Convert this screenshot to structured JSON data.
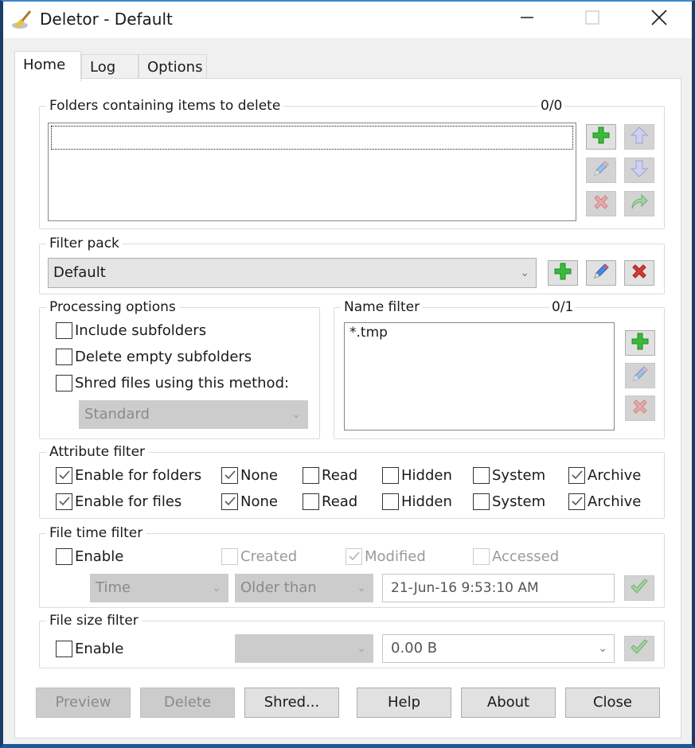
{
  "window": {
    "title": "Deletor - Default",
    "app_icon": "broom-icon",
    "controls": [
      "minimize-icon",
      "maximize-icon",
      "close-icon"
    ]
  },
  "tabs": [
    {
      "label": "Home",
      "active": true
    },
    {
      "label": "Log",
      "active": false
    },
    {
      "label": "Options",
      "active": false
    }
  ],
  "folders": {
    "label": "Folders containing items to delete",
    "count": "0/0",
    "items": [],
    "buttons": [
      {
        "name": "add",
        "icon": "plus-icon",
        "enabled": true
      },
      {
        "name": "move-up",
        "icon": "arrow-up-icon",
        "enabled": false
      },
      {
        "name": "edit",
        "icon": "pencil-icon",
        "enabled": false
      },
      {
        "name": "move-down",
        "icon": "arrow-down-icon",
        "enabled": false
      },
      {
        "name": "remove",
        "icon": "x-icon",
        "enabled": false
      },
      {
        "name": "open",
        "icon": "redo-arrow-icon",
        "enabled": false
      }
    ]
  },
  "filter_pack": {
    "label": "Filter pack",
    "selected": "Default"
  },
  "processing": {
    "label": "Processing options",
    "options": [
      {
        "label": "Include subfolders",
        "checked": false
      },
      {
        "label": "Delete empty subfolders",
        "checked": false
      },
      {
        "label": "Shred files using this method:",
        "checked": false
      }
    ],
    "shred_method": "Standard"
  },
  "name_filter": {
    "label": "Name filter",
    "count": "0/1",
    "items": [
      "*.tmp"
    ]
  },
  "attribute_filter": {
    "label": "Attribute filter",
    "rows": [
      {
        "enable_label": "Enable for folders",
        "enabled": true,
        "attrs": [
          {
            "label": "None",
            "checked": true
          },
          {
            "label": "Read",
            "checked": false
          },
          {
            "label": "Hidden",
            "checked": false
          },
          {
            "label": "System",
            "checked": false
          },
          {
            "label": "Archive",
            "checked": true
          }
        ]
      },
      {
        "enable_label": "Enable for files",
        "enabled": true,
        "attrs": [
          {
            "label": "None",
            "checked": true
          },
          {
            "label": "Read",
            "checked": false
          },
          {
            "label": "Hidden",
            "checked": false
          },
          {
            "label": "System",
            "checked": false
          },
          {
            "label": "Archive",
            "checked": true
          }
        ]
      }
    ]
  },
  "file_time": {
    "label": "File time filter",
    "enable_label": "Enable",
    "enabled": false,
    "created_label": "Created",
    "created": false,
    "modified_label": "Modified",
    "modified": true,
    "accessed_label": "Accessed",
    "accessed": false,
    "mode": "Time",
    "comparison": "Older than",
    "datetime": "21-Jun-16 9:53:10 AM"
  },
  "file_size": {
    "label": "File size filter",
    "enable_label": "Enable",
    "enabled": false,
    "comparison": "",
    "size": "0.00 B"
  },
  "buttons": {
    "preview": "Preview",
    "delete": "Delete",
    "shred": "Shred...",
    "help": "Help",
    "about": "About",
    "close": "Close"
  },
  "colors": {
    "titlebar_accent": "#3a86d0",
    "window_border": "#1a3e66",
    "add_green": "#3cba3c",
    "remove_red": "#d93a3a",
    "arrow_purple": "#a8a8e8"
  }
}
